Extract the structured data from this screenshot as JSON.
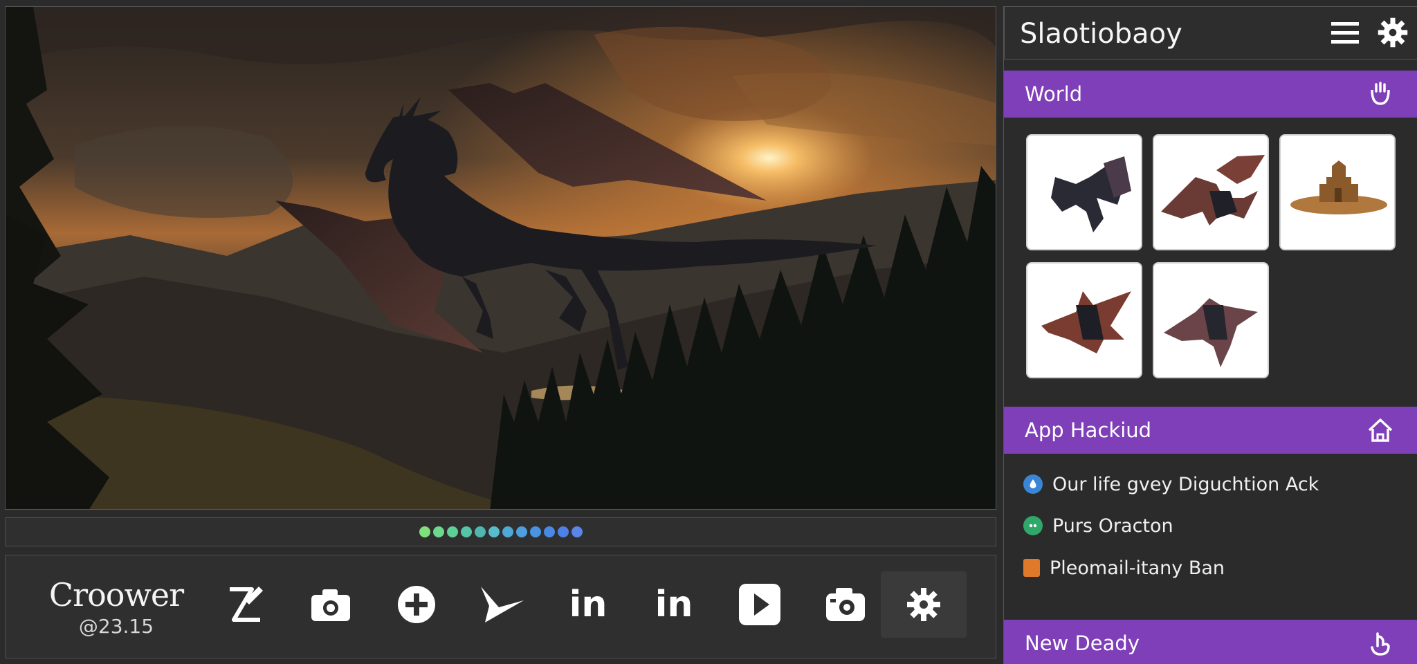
{
  "sidebar": {
    "title": "Slaotiobaoy",
    "sections": {
      "world": {
        "label": "World"
      },
      "app": {
        "label": "App Hackiud"
      },
      "new": {
        "label": "New Deady"
      }
    },
    "activity": [
      {
        "text": "Our life gvey Diguchtion Ack",
        "color": "#3a86d6"
      },
      {
        "text": "Purs Oracton",
        "color": "#2fa86a"
      },
      {
        "text": "Pleomail-itany Ban",
        "color": "#e07a2a"
      }
    ]
  },
  "toolbar": {
    "brand_name": "Croower",
    "brand_version": "@23.15",
    "linkedin_label": "in",
    "linkedin_label_2": "in"
  },
  "progress_dots": [
    "#7fe07e",
    "#6cd98c",
    "#5fcf98",
    "#56c4a6",
    "#4fb7b0",
    "#58bccd",
    "#4ea9d6",
    "#4f9fde",
    "#4a93e2",
    "#4a88e6",
    "#4d80e8",
    "#5a86ea"
  ],
  "colors": {
    "accent": "#7e3fb8",
    "panel": "#2f2f2f",
    "background": "#2b2b2b"
  }
}
